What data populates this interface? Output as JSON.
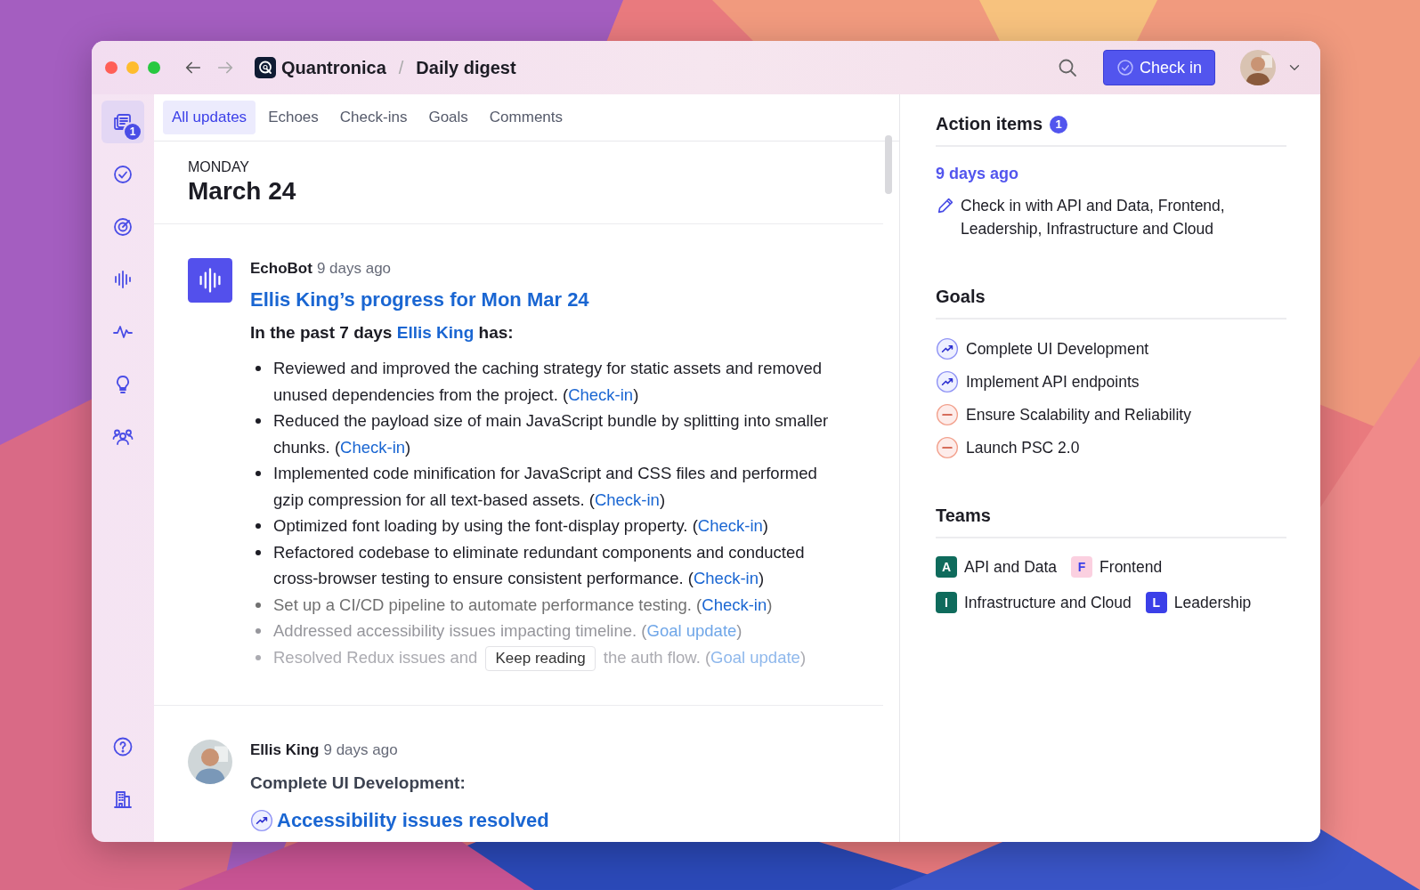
{
  "window": {
    "app": "Quantronica",
    "separator": "/",
    "title": "Daily digest",
    "back_disabled": false,
    "forward_disabled": true,
    "check_in_button": "Check in"
  },
  "sidebar": {
    "items": [
      {
        "selected": true,
        "badge": "1"
      },
      {
        "selected": false
      },
      {
        "selected": false
      },
      {
        "selected": false
      },
      {
        "selected": false
      },
      {
        "selected": false
      },
      {
        "selected": false
      }
    ],
    "footer_items": [
      {
        "selected": false
      },
      {
        "selected": false
      }
    ]
  },
  "tabs": [
    {
      "label": "All updates",
      "selected": true
    },
    {
      "label": "Echoes",
      "selected": false
    },
    {
      "label": "Check-ins",
      "selected": false
    },
    {
      "label": "Goals",
      "selected": false
    },
    {
      "label": "Comments",
      "selected": false
    }
  ],
  "day": {
    "weekday": "MONDAY",
    "date": "March 24"
  },
  "posts": [
    {
      "kind": "digest",
      "author": "EchoBot",
      "time": "9 days ago",
      "title": "Ellis King’s progress for Mon Mar 24",
      "intro_before": "In the past 7 days",
      "intro_link": "Ellis King",
      "intro_after": "has:",
      "items": [
        {
          "text": "Reviewed and improved the caching strategy for static assets and removed unused dependencies from the project. (",
          "link": "Check-in",
          "after": ")"
        },
        {
          "text": "Reduced the payload size of main JavaScript bundle by splitting into smaller chunks. (",
          "link": "Check-in",
          "after": ")"
        },
        {
          "text": "Implemented code minification for JavaScript and CSS files and performed gzip compression for all text-based assets. (",
          "link": "Check-in",
          "after": ")"
        },
        {
          "text": "Optimized font loading by using the font-display property. (",
          "link": "Check-in",
          "after": ")"
        },
        {
          "text": "Refactored codebase to eliminate redundant components and conducted cross-browser testing to ensure consistent performance. (",
          "link": "Check-in",
          "after": ")"
        },
        {
          "text": "Set up a CI/CD pipeline to automate performance testing. (",
          "link": "Check-in",
          "after": ")"
        },
        {
          "text": "Addressed accessibility issues impacting timeline. (",
          "link": "Goal update",
          "after": ")"
        },
        {
          "text": "Resolved Redux issues and",
          "covered_by": "Keep reading",
          "text_after": "the auth flow. (",
          "link": "Goal update",
          "after": ")"
        }
      ]
    },
    {
      "kind": "goal_update",
      "author": "Ellis King",
      "time": "9 days ago",
      "goal": "Complete UI Development:",
      "update": "Accessibility issues resolved"
    }
  ],
  "action_items": {
    "title": "Action items",
    "count": "1",
    "groups": [
      {
        "time": "9 days ago",
        "items": [
          {
            "text": "Check in with API and Data, Frontend, Leadership, Infrastructure and Cloud"
          }
        ]
      }
    ]
  },
  "goals": {
    "title": "Goals",
    "items": [
      {
        "name": "Complete UI Development",
        "kind": "on_track"
      },
      {
        "name": "Implement API endpoints",
        "kind": "on_track"
      },
      {
        "name": "Ensure Scalability and Reliability",
        "kind": "off_track"
      },
      {
        "name": "Launch PSC 2.0",
        "kind": "off_track"
      }
    ]
  },
  "teams": {
    "title": "Teams",
    "items": [
      {
        "letter": "A",
        "name": "API and Data",
        "color": "#0f6b5c"
      },
      {
        "letter": "F",
        "name": "Frontend",
        "color": "#fbd0e0"
      },
      {
        "letter": "I",
        "name": "Infrastructure and Cloud",
        "color": "#0f6b5c"
      },
      {
        "letter": "L",
        "name": "Leadership",
        "color": "#3b3fe8"
      }
    ]
  }
}
